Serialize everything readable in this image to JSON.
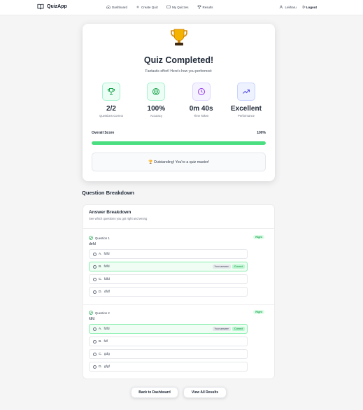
{
  "nav": {
    "brand": "QuizApp",
    "links": [
      {
        "label": "Dashboard",
        "icon": "home-icon"
      },
      {
        "label": "Create Quiz",
        "icon": "plus-icon"
      },
      {
        "label": "My Quizzes",
        "icon": "book-icon"
      },
      {
        "label": "Results",
        "icon": "trophy-icon"
      }
    ],
    "user": "Lekharu",
    "logout": "Logout"
  },
  "result": {
    "trophy_icon": "trophy-emoji",
    "title": "Quiz Completed!",
    "subtitle": "Fantastic effort! Here's how you performed:",
    "stats": [
      {
        "value": "2/2",
        "label": "Questions Correct",
        "icon": "trophy-icon",
        "color": "#16a34a",
        "bg": "#ecfdf5",
        "border": "#a7f3d0"
      },
      {
        "value": "100%",
        "label": "Accuracy",
        "icon": "target-icon",
        "color": "#16a34a",
        "bg": "#ecfdf5",
        "border": "#a7f3d0"
      },
      {
        "value": "0m 40s",
        "label": "Time Taken",
        "icon": "clock-icon",
        "color": "#9333ea",
        "bg": "#f5f3ff",
        "border": "#ddd6fe"
      },
      {
        "value": "Excellent",
        "label": "Performance",
        "icon": "trending-up-icon",
        "color": "#4f46e5",
        "bg": "#eef2ff",
        "border": "#c7d2fe"
      }
    ],
    "overall_label": "Overall Score",
    "overall_value": "100%",
    "overall_fraction": 1.0,
    "message": "🏆 Outstanding! You're a quiz master!"
  },
  "breakdown": {
    "section_title": "Question Breakdown",
    "title": "Answer Breakdown",
    "subtitle": "See which questions you got right and wrong",
    "questions": [
      {
        "label": "Question 1",
        "text": "defd",
        "badge": "Right",
        "options": [
          {
            "letter": "A.",
            "text": "fdfd",
            "correct": false,
            "yours": false
          },
          {
            "letter": "B.",
            "text": "fdfd",
            "correct": true,
            "yours": true
          },
          {
            "letter": "C.",
            "text": "fdfd",
            "correct": false,
            "yours": false
          },
          {
            "letter": "D.",
            "text": "dfdf",
            "correct": false,
            "yours": false
          }
        ]
      },
      {
        "label": "Question 2",
        "text": "fdfd",
        "badge": "Right",
        "options": [
          {
            "letter": "A.",
            "text": "fdfd",
            "correct": true,
            "yours": true
          },
          {
            "letter": "B.",
            "text": "fdf",
            "correct": false,
            "yours": false
          },
          {
            "letter": "C.",
            "text": "gdg",
            "correct": false,
            "yours": false
          },
          {
            "letter": "D.",
            "text": "gfgf",
            "correct": false,
            "yours": false
          }
        ]
      }
    ],
    "your_answer_label": "Your answer",
    "correct_label": "Correct"
  },
  "buttons": {
    "back": "Back to Dashboard",
    "all_results": "View All Results"
  }
}
